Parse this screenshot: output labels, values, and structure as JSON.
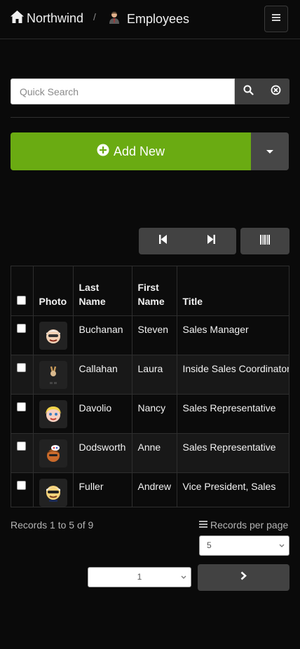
{
  "header": {
    "brand": "Northwind",
    "separator": "/",
    "page_title": "Employees"
  },
  "search": {
    "placeholder": "Quick Search",
    "value": ""
  },
  "toolbar": {
    "add_new_label": "Add New"
  },
  "table": {
    "columns": [
      "Photo",
      "Last Name",
      "First Name",
      "Title"
    ],
    "column_lines": {
      "last_name": [
        "Last",
        "Name"
      ],
      "first_name": [
        "First",
        "Name"
      ]
    },
    "rows": [
      {
        "last_name": "Buchanan",
        "first_name": "Steven",
        "title": "Sales Manager"
      },
      {
        "last_name": "Callahan",
        "first_name": "Laura",
        "title": "Inside Sales Coordinator"
      },
      {
        "last_name": "Davolio",
        "first_name": "Nancy",
        "title": "Sales Representative"
      },
      {
        "last_name": "Dodsworth",
        "first_name": "Anne",
        "title": "Sales Representative"
      },
      {
        "last_name": "Fuller",
        "first_name": "Andrew",
        "title": "Vice President, Sales"
      }
    ]
  },
  "footer": {
    "records_text": "Records 1 to 5 of 9",
    "records_per_page_label": "Records per page",
    "records_per_page_value": "5",
    "page_value": "1"
  },
  "colors": {
    "accent": "#6aab12",
    "button": "#424242",
    "background": "#0a0a0a"
  }
}
